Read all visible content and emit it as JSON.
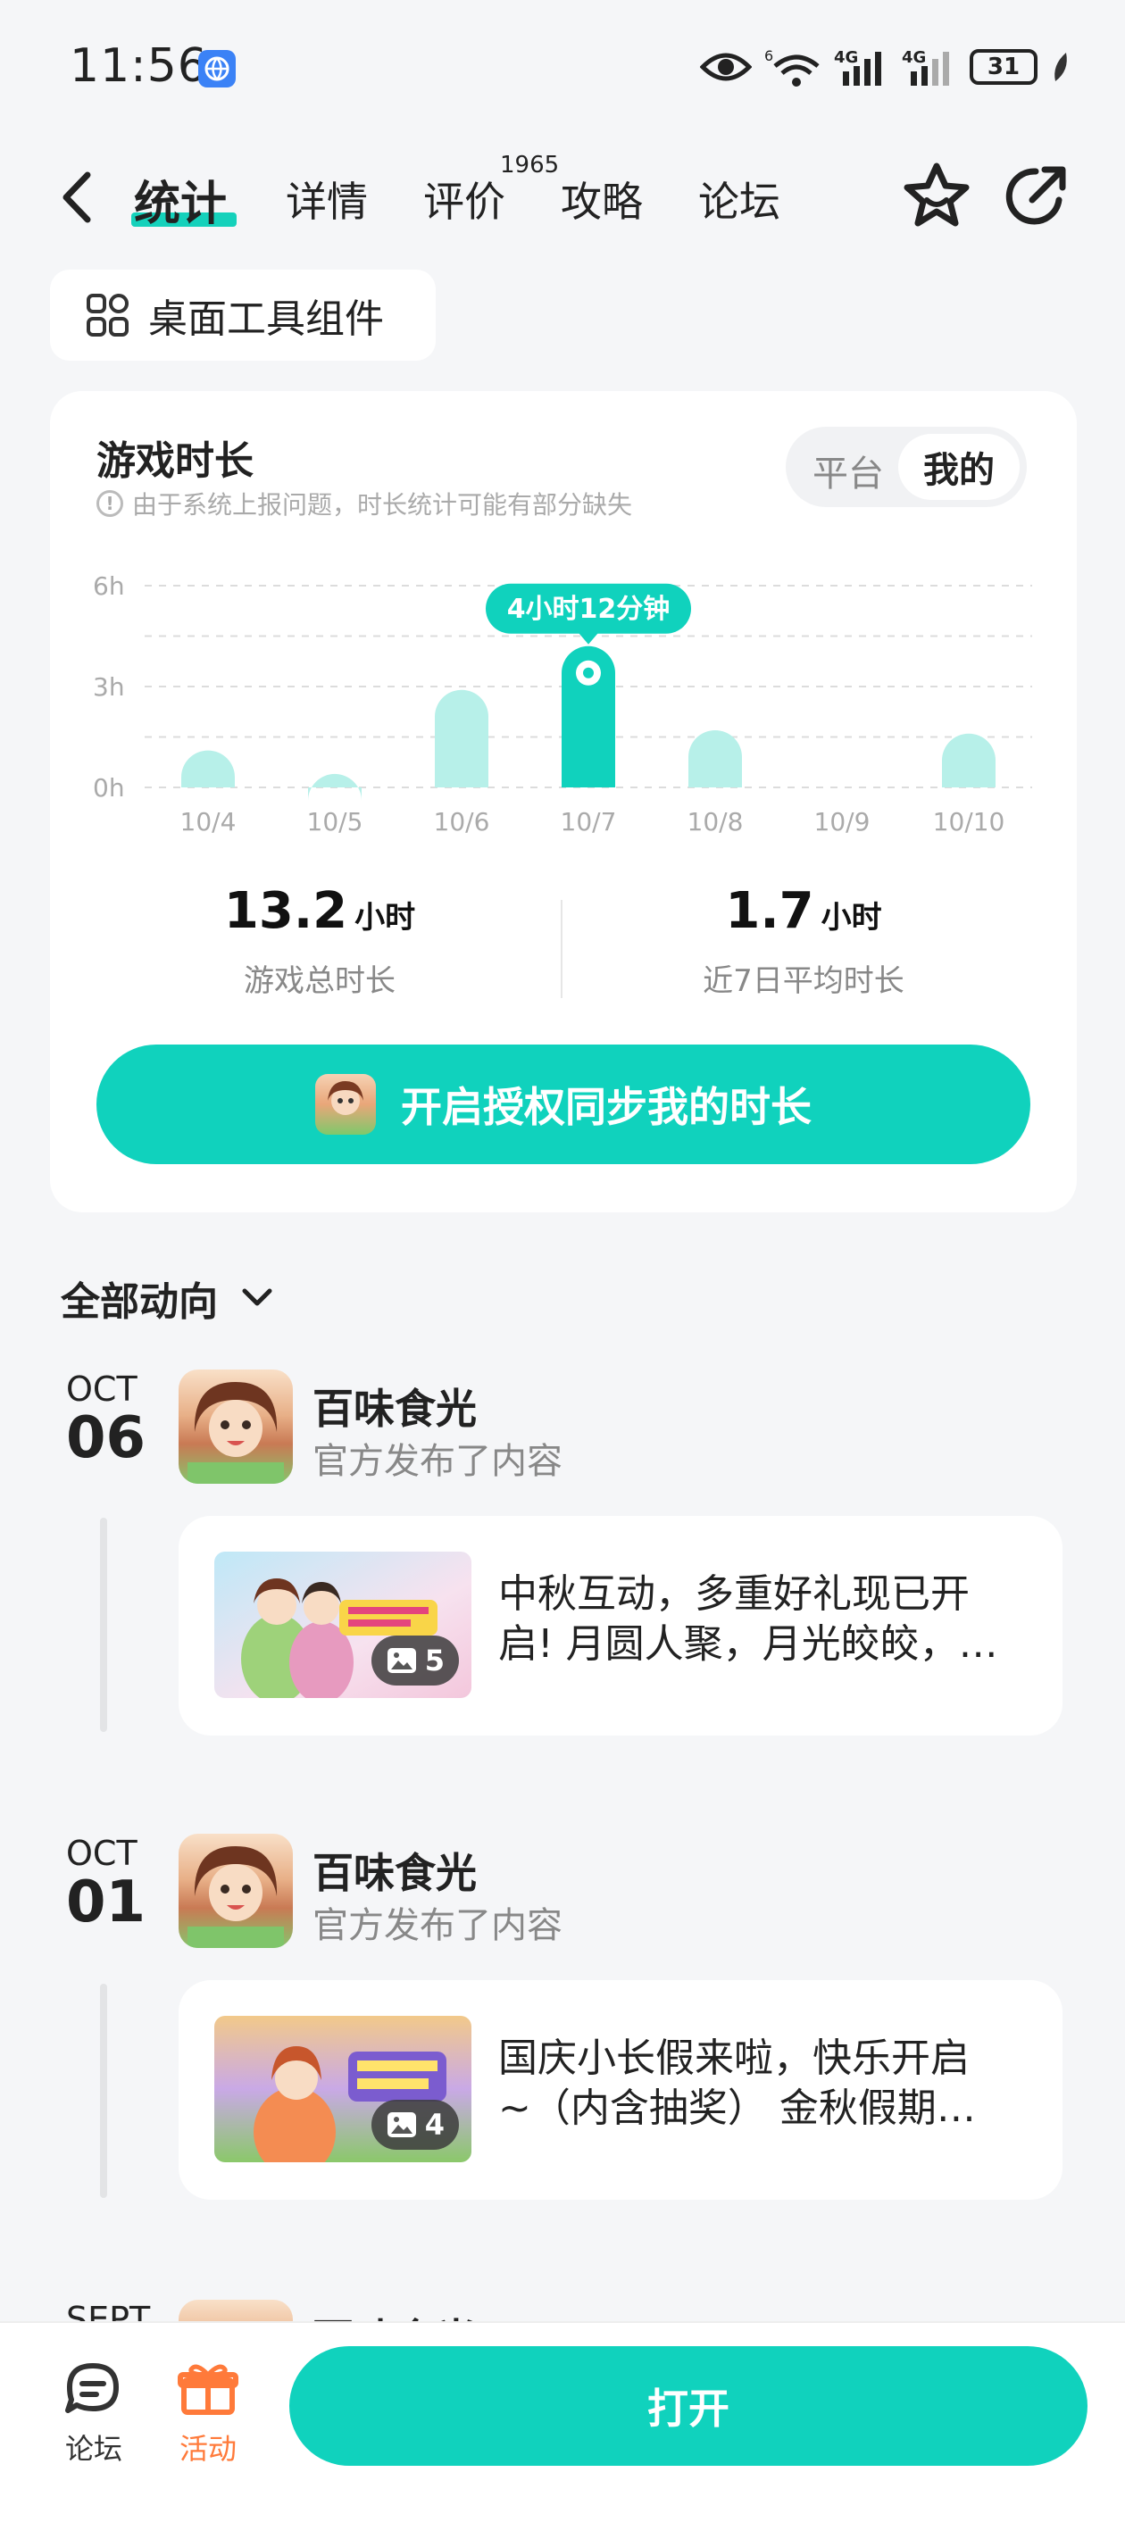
{
  "status_bar": {
    "time": "11:56",
    "network_1": "4G",
    "network_2": "4G",
    "wifi_sup": "6",
    "battery": "31"
  },
  "nav": {
    "tabs": [
      {
        "label": "统计"
      },
      {
        "label": "详情"
      },
      {
        "label": "评价"
      },
      {
        "label": "攻略"
      },
      {
        "label": "论坛"
      }
    ],
    "review_count": "1965"
  },
  "widget_chip": {
    "label": "桌面工具组件"
  },
  "stats_card": {
    "title": "游戏时长",
    "note": "由于系统上报问题，时长统计可能有部分缺失",
    "toggle": {
      "platform": "平台",
      "mine": "我的",
      "selected": "我的"
    },
    "tooltip": "4小时12分钟",
    "total": {
      "value": "13.2",
      "unit": "小时",
      "label": "游戏总时长"
    },
    "avg": {
      "value": "1.7",
      "unit": "小时",
      "label": "近7日平均时长"
    },
    "sync_button": "开启授权同步我的时长"
  },
  "chart_data": {
    "type": "bar",
    "categories": [
      "10/4",
      "10/5",
      "10/6",
      "10/7",
      "10/8",
      "10/9",
      "10/10"
    ],
    "values": [
      1.1,
      0.4,
      2.9,
      4.2,
      1.7,
      0,
      1.6
    ],
    "yticks": [
      "0h",
      "3h",
      "6h"
    ],
    "ylim": [
      0,
      6
    ],
    "highlighted_index": 3,
    "colors": {
      "bar": "#b7f0e9",
      "highlight": "#10d2bd"
    }
  },
  "feed": {
    "filter_label": "全部动向",
    "items": [
      {
        "month": "OCT",
        "day": "06",
        "game": "百味食光",
        "action": "官方发布了内容",
        "text": "中秋互动，多重好礼现已开启! 月圆人聚，月光皎皎，…",
        "line1": "中秋互动，多重好礼现已开",
        "line2": "启! 月圆人聚，月光皎皎，…",
        "image_count": "5"
      },
      {
        "month": "OCT",
        "day": "01",
        "game": "百味食光",
        "action": "官方发布了内容",
        "line1": "国庆小长假来啦，快乐开启",
        "line2": "~（内含抽奖） 金秋假期…",
        "image_count": "4"
      },
      {
        "month": "SEPT",
        "game": "百味食光"
      }
    ]
  },
  "bottom_bar": {
    "forum": "论坛",
    "activity": "活动",
    "open": "打开"
  }
}
